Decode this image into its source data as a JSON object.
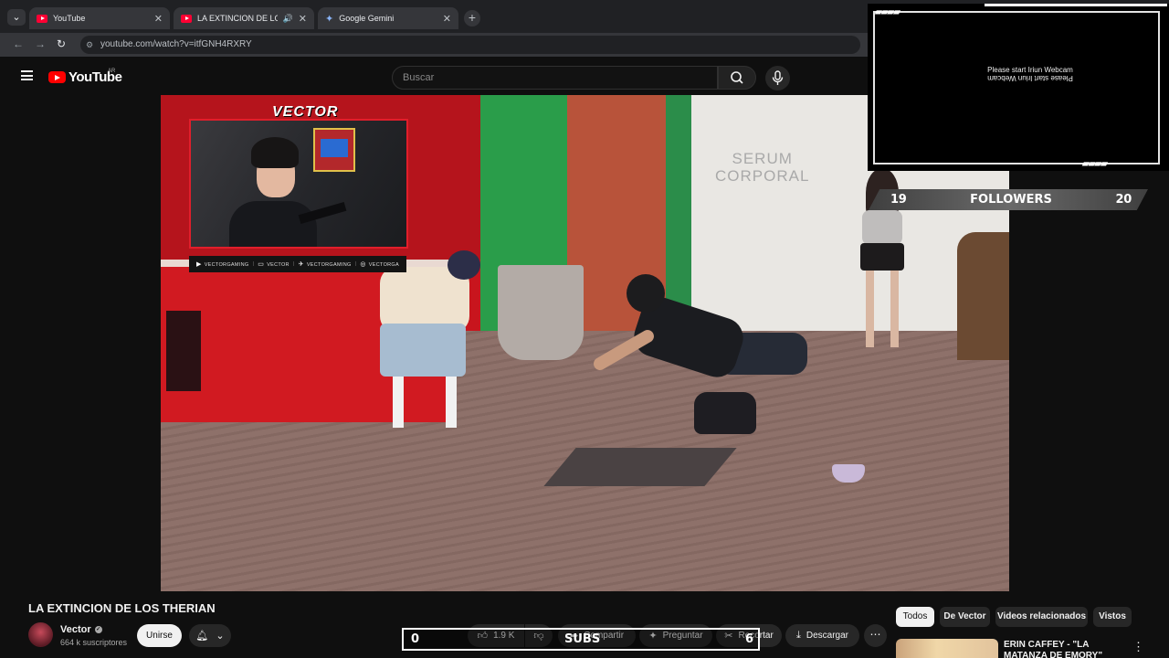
{
  "browser": {
    "tabs": [
      {
        "title": "YouTube"
      },
      {
        "title": "LA EXTINCION DE LOS THERIAN"
      },
      {
        "title": "Google Gemini"
      }
    ],
    "url": "youtube.com/watch?v=itfGNH4RXRY"
  },
  "header": {
    "logo_text": "YouTube",
    "country": "AR",
    "search_placeholder": "Buscar"
  },
  "video": {
    "store_sign": "SERUM\nCORPORAL",
    "overlay": {
      "streamer_label": "VECTOR",
      "socials": [
        {
          "icon": "youtube-icon",
          "text": "VECTORGAMING"
        },
        {
          "icon": "twitch-icon",
          "text": "VECTOR"
        },
        {
          "icon": "twitter-icon",
          "text": "VECTORGAMING"
        },
        {
          "icon": "instagram-icon",
          "text": "VECTORGA"
        }
      ]
    }
  },
  "stream_widget": {
    "webcam_text": "Please start Iriun Webcam",
    "followers": {
      "left": "19",
      "label": "FOLLOWERS",
      "right": "20"
    }
  },
  "details": {
    "title": "LA EXTINCION DE LOS THERIAN",
    "channel": "Vector",
    "subscribers": "664 k suscriptores",
    "join_label": "Unirse",
    "likes": "1.9 K",
    "share_label": "Compartir",
    "ask_label": "Preguntar",
    "clip_label": "Recortar",
    "download_label": "Descargar"
  },
  "subs_overlay": {
    "left": "0",
    "label": "SUBS",
    "right": "6"
  },
  "sidebar_chips": [
    "Todos",
    "De Vector",
    "Videos relacionados",
    "Vistos"
  ],
  "recommendation": {
    "title": "ERIN CAFFEY - \"LA MATANZA DE EMORY\""
  },
  "colors": {
    "accent": "#ff0000",
    "background": "#0f0f0f",
    "overlay_red": "#e11e2b"
  }
}
